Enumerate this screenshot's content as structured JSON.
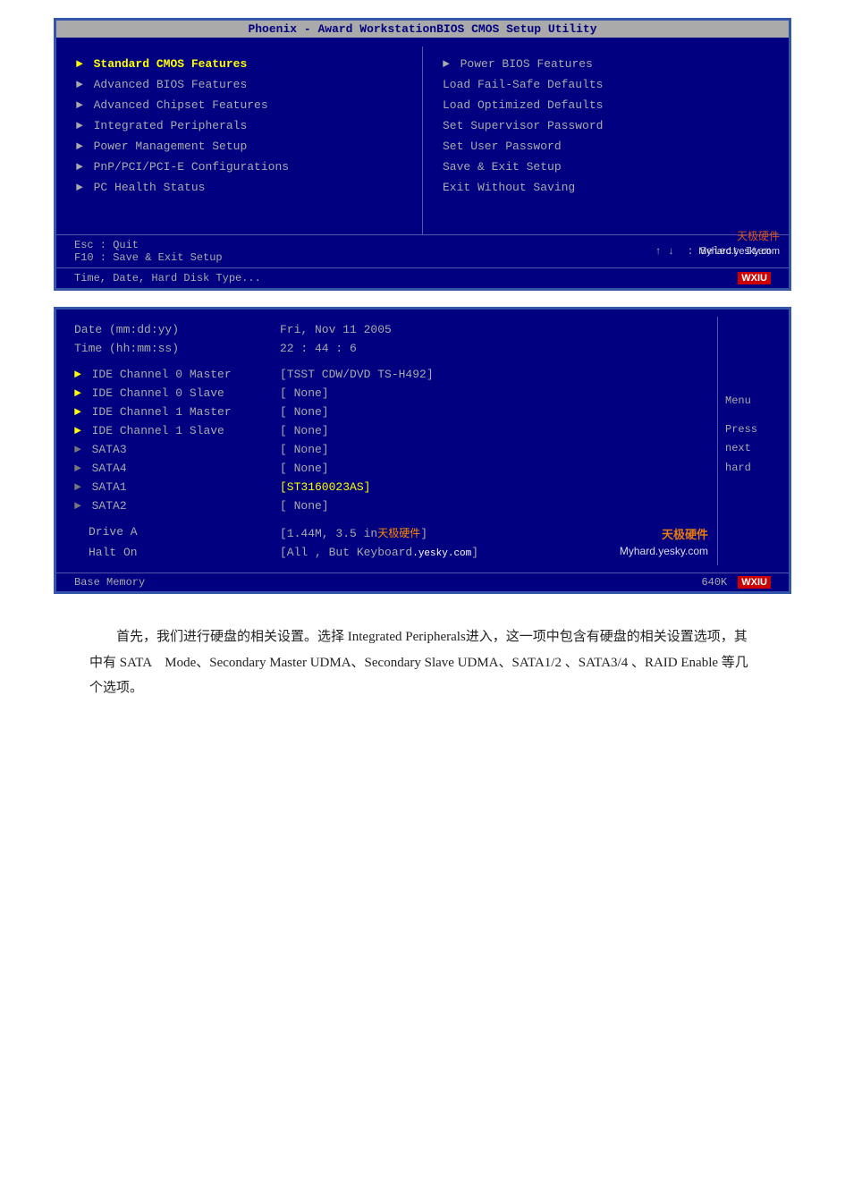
{
  "page": {
    "background": "#ffffff"
  },
  "bios1": {
    "title": "Phoenix - Award WorkstationBIOS CMOS Setup Utility",
    "left_menu": [
      {
        "label": "Standard CMOS Features",
        "has_arrow": true,
        "selected": true
      },
      {
        "label": "Advanced BIOS Features",
        "has_arrow": true,
        "selected": false
      },
      {
        "label": "Advanced Chipset Features",
        "has_arrow": true,
        "selected": false
      },
      {
        "label": "Integrated Peripherals",
        "has_arrow": true,
        "selected": false
      },
      {
        "label": "Power Management Setup",
        "has_arrow": true,
        "selected": false
      },
      {
        "label": "PnP/PCI/PCI-E Configurations",
        "has_arrow": true,
        "selected": false
      },
      {
        "label": "PC Health Status",
        "has_arrow": true,
        "selected": false
      }
    ],
    "right_menu": [
      {
        "label": "Power BIOS Features",
        "has_arrow": true
      },
      {
        "label": "Load Fail-Safe Defaults",
        "has_arrow": false
      },
      {
        "label": "Load Optimized Defaults",
        "has_arrow": false
      },
      {
        "label": "Set Supervisor Password",
        "has_arrow": false
      },
      {
        "label": "Set User Password",
        "has_arrow": false
      },
      {
        "label": "Save & Exit Setup",
        "has_arrow": false
      },
      {
        "label": "Exit Without Saving",
        "has_arrow": false
      }
    ],
    "footer_left1": "Esc : Quit",
    "footer_left2": "F10 : Save & Exit Setup",
    "footer_right": ": Select Item",
    "status_bar": "Time, Date, Hard Disk Type...",
    "watermark_tianji": "天极硬件",
    "watermark_myhard": "Myhard.yesky.com",
    "wxiu": "WXIU"
  },
  "bios2": {
    "rows": [
      {
        "label": "Date (mm:dd:yy)",
        "value": "Fri, Nov 11 2005",
        "arrow": "none"
      },
      {
        "label": "Time (hh:mm:ss)",
        "value": "22 : 44 :  6",
        "arrow": "none"
      },
      {
        "label": "",
        "value": "",
        "arrow": "none"
      },
      {
        "label": "IDE Channel 0 Master",
        "value": "[TSST CDW/DVD TS-H492]",
        "arrow": "yellow"
      },
      {
        "label": "IDE Channel 0 Slave",
        "value": "[ None]",
        "arrow": "yellow"
      },
      {
        "label": "IDE Channel 1 Master",
        "value": "[ None]",
        "arrow": "yellow"
      },
      {
        "label": "IDE Channel 1 Slave",
        "value": "[ None]",
        "arrow": "yellow"
      },
      {
        "label": "SATA3",
        "value": "[ None]",
        "arrow": "gray"
      },
      {
        "label": "SATA4",
        "value": "[ None]",
        "arrow": "gray"
      },
      {
        "label": "SATA1",
        "value": "[ST3160023AS]",
        "arrow": "gray"
      },
      {
        "label": "SATA2",
        "value": "[ None]",
        "arrow": "gray"
      },
      {
        "label": "",
        "value": "",
        "arrow": "none"
      },
      {
        "label": "Drive A",
        "value": "[1.44M, 3.5 in天极硬件]",
        "arrow": "none"
      },
      {
        "label": "Halt On",
        "value": "[All , But Keyboard]",
        "arrow": "none"
      }
    ],
    "side_menu": [
      "Menu",
      "",
      "Press",
      "next",
      "hard"
    ],
    "footer_left": "Base Memory",
    "footer_value": "640K",
    "wxiu": "WXIU",
    "watermark_tianji": "天极硬件",
    "watermark_myhard": "Myhard.yesky.com"
  },
  "article": {
    "paragraph": "首先，我们进行硬盘的相关设置。选择 Integrated Peripherals进入，这一项中包含有硬盘的相关设置选项，其中有 SATA　Mode、Secondary Master UDMA、Secondary Slave UDMA、SATA1/2 、SATA3/4 、RAID Enable 等几个选项。"
  }
}
